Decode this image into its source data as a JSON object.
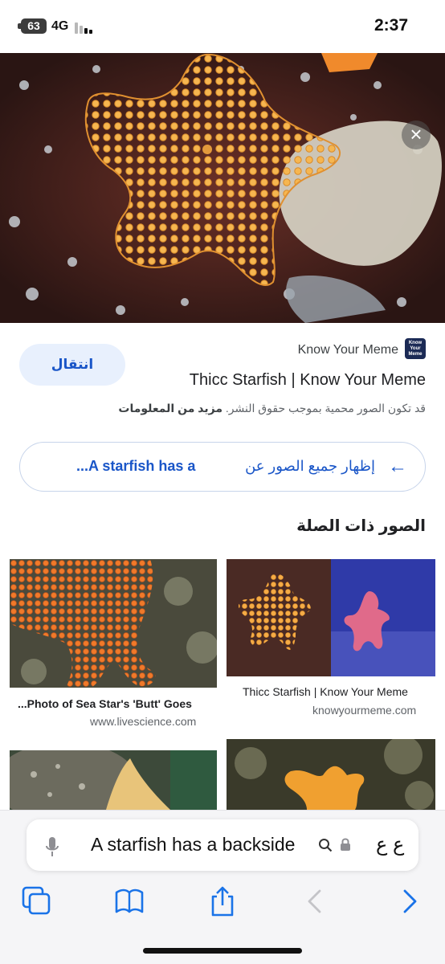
{
  "status_bar": {
    "battery": "63",
    "network": "4G",
    "time": "2:37"
  },
  "hero": {
    "icon": "close-icon"
  },
  "result": {
    "goto_label": "انتقال",
    "source_logo_text": "Know Your Meme",
    "source_name": "Know Your Meme",
    "title": "Thicc Starfish | Know Your Meme",
    "copyright_text": "قد تكون الصور محمية بموجب حقوق النشر.",
    "more_info_link": "مزيد من المعلومات"
  },
  "show_all": {
    "label": "إظهار جميع الصور عن",
    "query": "A starfish has a...",
    "icon": "arrow-left-icon"
  },
  "related": {
    "heading": "الصور ذات الصلة",
    "tiles": [
      {
        "caption": "...Photo of Sea Star's 'Butt' Goes",
        "domain": "www.livescience.com"
      },
      {
        "caption": "Thicc Starfish | Know Your Meme",
        "domain": "knowyourmeme.com"
      },
      {
        "caption": "",
        "domain": ""
      },
      {
        "caption": "",
        "domain": ""
      }
    ]
  },
  "address_bar": {
    "text": "A starfish has a backside",
    "reader_label": "ع ع",
    "icons": [
      "mic-icon",
      "search-icon",
      "lock-icon"
    ]
  },
  "toolbar": {
    "icons": [
      "tabs-icon",
      "bookmarks-icon",
      "share-icon",
      "back-icon",
      "forward-icon"
    ]
  },
  "colors": {
    "accent": "#1a56c8",
    "pill_bg": "#e8f0fd",
    "starfish": "#f2a23a"
  }
}
